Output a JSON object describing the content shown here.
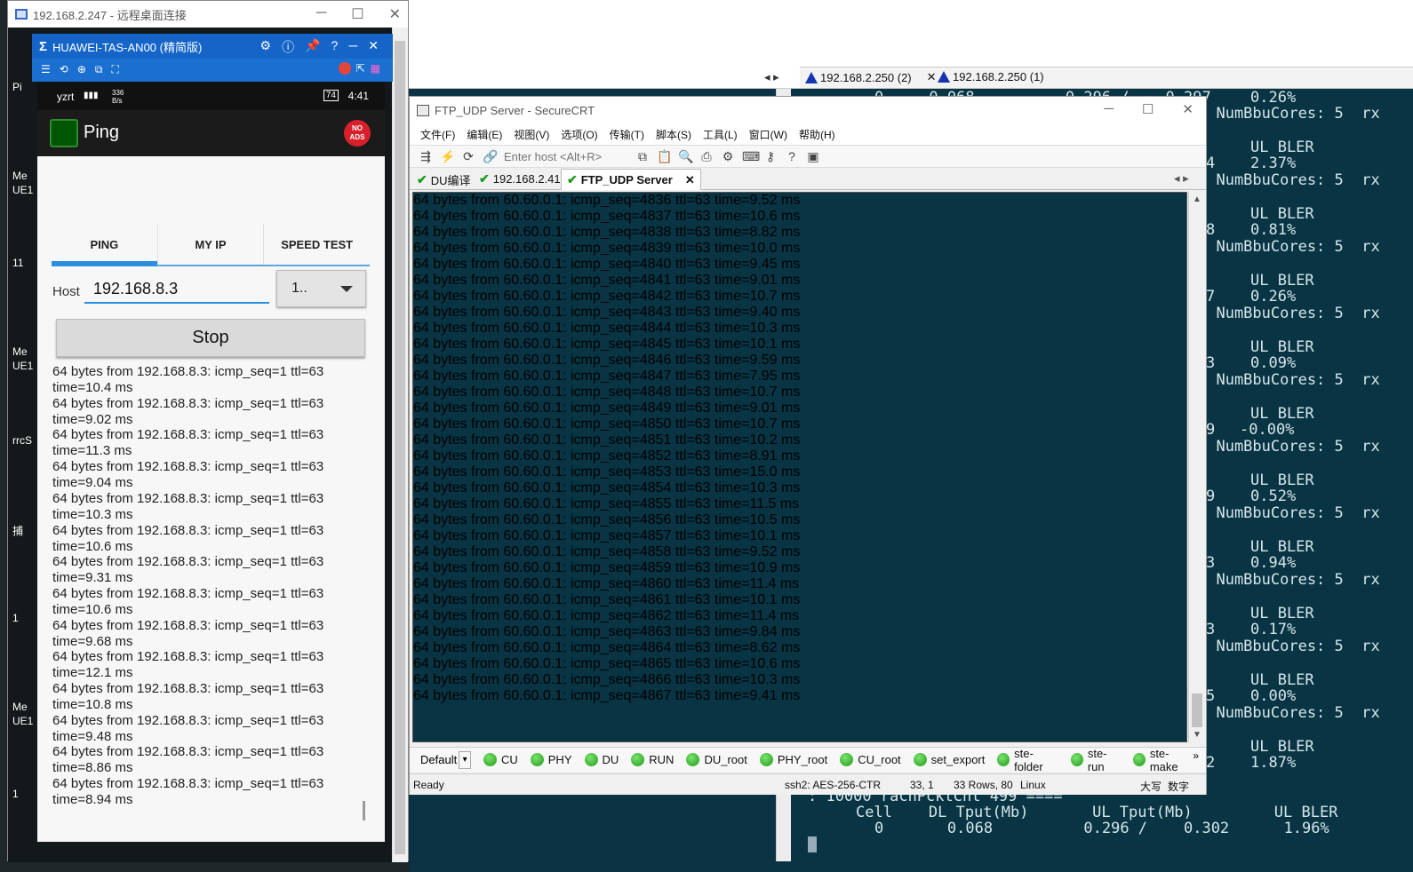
{
  "bg_window": {
    "tabs": [
      "192.168.2.250 (2)",
      "192.168.2.250 (1)"
    ],
    "rows": [
      [
        "0",
        "0.068",
        "0.296 /",
        "0.297",
        "0.26%"
      ],
      [
        "L NumBbuCores: 5  rx"
      ],
      [
        "",
        "",
        "",
        "UL BLER",
        ""
      ],
      [
        "4",
        "",
        "",
        "2.37%",
        ""
      ]
    ],
    "right_blocks": [
      {
        "label": "UL BLER",
        "value": "2.37%"
      },
      {
        "label": "UL BLER",
        "value": "0.81%"
      },
      {
        "label": "UL BLER",
        "value": "0.26%"
      },
      {
        "label": "UL BLER",
        "value": "0.09%"
      },
      {
        "label": "UL BLER",
        "value": "-0.00%"
      },
      {
        "label": "UL BLER",
        "value": "0.52%"
      },
      {
        "label": "UL BLER",
        "value": "0.94%"
      },
      {
        "label": "UL BLER",
        "value": "0.17%"
      },
      {
        "label": "UL BLER",
        "value": "0.00%"
      },
      {
        "label": "UL BLER",
        "value": "1.87%"
      }
    ],
    "top_value": "0.26%",
    "cores_line": "L NumBbuCores: 5  rx",
    "left_digits": [
      "4",
      "8",
      "7",
      "3",
      "9",
      "9",
      "3",
      "3",
      "5",
      "2"
    ],
    "footer_line1": ": 10000 rachPcktCnt 499 ====",
    "footer_header": "Cell    DL Tput(Mb)       UL Tput(Mb)         UL BLER",
    "footer_values": "0       0.068          0.296 /    0.302      1.96%",
    "top_partial": "0     0.068          0.296 /    0.297"
  },
  "rdp": {
    "title": "192.168.2.247 - 远程桌面连接",
    "side_labels": [
      "Pi",
      "Me",
      "UE1",
      "11",
      "Me",
      "UE1",
      "rrcS",
      "捕",
      "1",
      "Me",
      "UE1",
      "1"
    ]
  },
  "mirror": {
    "title": "HUAWEI-TAS-AN00 (精简版)"
  },
  "phone": {
    "status_left": "yzrt",
    "status_speed": "336 B/s",
    "battery": "74",
    "time": "4:41",
    "app_title": "Ping",
    "ads_badge": "NO ADS",
    "tabs": [
      "PING",
      "MY IP",
      "SPEED TEST"
    ],
    "host_label": "Host",
    "host_value": "192.168.8.3",
    "count_value": "1..",
    "stop_label": "Stop",
    "ping_lines": [
      [
        "64 bytes from 192.168.8.3: icmp_seq=1 ttl=63",
        "time=10.4 ms"
      ],
      [
        "64 bytes from 192.168.8.3: icmp_seq=1 ttl=63",
        "time=9.02 ms"
      ],
      [
        "64 bytes from 192.168.8.3: icmp_seq=1 ttl=63",
        "time=11.3 ms"
      ],
      [
        "64 bytes from 192.168.8.3: icmp_seq=1 ttl=63",
        "time=9.04 ms"
      ],
      [
        "64 bytes from 192.168.8.3: icmp_seq=1 ttl=63",
        "time=10.3 ms"
      ],
      [
        "64 bytes from 192.168.8.3: icmp_seq=1 ttl=63",
        "time=10.6 ms"
      ],
      [
        "64 bytes from 192.168.8.3: icmp_seq=1 ttl=63",
        "time=9.31 ms"
      ],
      [
        "64 bytes from 192.168.8.3: icmp_seq=1 ttl=63",
        "time=10.6 ms"
      ],
      [
        "64 bytes from 192.168.8.3: icmp_seq=1 ttl=63",
        "time=9.68 ms"
      ],
      [
        "64 bytes from 192.168.8.3: icmp_seq=1 ttl=63",
        "time=12.1 ms"
      ],
      [
        "64 bytes from 192.168.8.3: icmp_seq=1 ttl=63",
        "time=10.8 ms"
      ],
      [
        "64 bytes from 192.168.8.3: icmp_seq=1 ttl=63",
        "time=9.48 ms"
      ],
      [
        "64 bytes from 192.168.8.3: icmp_seq=1 ttl=63",
        "time=8.86 ms"
      ],
      [
        "64 bytes from 192.168.8.3: icmp_seq=1 ttl=63",
        "time=8.94 ms"
      ]
    ]
  },
  "crt": {
    "title": "FTP_UDP Server - SecureCRT",
    "menu": [
      "文件(F)",
      "编辑(E)",
      "视图(V)",
      "选项(O)",
      "传输(T)",
      "脚本(S)",
      "工具(L)",
      "窗口(W)",
      "帮助(H)"
    ],
    "host_placeholder": "Enter host <Alt+R>",
    "tabs": [
      "DU编译",
      "192.168.2.41",
      "FTP_UDP Server"
    ],
    "terminal_lines": [
      "64 bytes from 60.60.0.1: icmp_seq=4836 ttl=63 time=9.52 ms",
      "64 bytes from 60.60.0.1: icmp_seq=4837 ttl=63 time=10.6 ms",
      "64 bytes from 60.60.0.1: icmp_seq=4838 ttl=63 time=8.82 ms",
      "64 bytes from 60.60.0.1: icmp_seq=4839 ttl=63 time=10.0 ms",
      "64 bytes from 60.60.0.1: icmp_seq=4840 ttl=63 time=9.45 ms",
      "64 bytes from 60.60.0.1: icmp_seq=4841 ttl=63 time=9.01 ms",
      "64 bytes from 60.60.0.1: icmp_seq=4842 ttl=63 time=10.7 ms",
      "64 bytes from 60.60.0.1: icmp_seq=4843 ttl=63 time=9.40 ms",
      "64 bytes from 60.60.0.1: icmp_seq=4844 ttl=63 time=10.3 ms",
      "64 bytes from 60.60.0.1: icmp_seq=4845 ttl=63 time=10.1 ms",
      "64 bytes from 60.60.0.1: icmp_seq=4846 ttl=63 time=9.59 ms",
      "64 bytes from 60.60.0.1: icmp_seq=4847 ttl=63 time=7.95 ms",
      "64 bytes from 60.60.0.1: icmp_seq=4848 ttl=63 time=10.7 ms",
      "64 bytes from 60.60.0.1: icmp_seq=4849 ttl=63 time=9.01 ms",
      "64 bytes from 60.60.0.1: icmp_seq=4850 ttl=63 time=10.7 ms",
      "64 bytes from 60.60.0.1: icmp_seq=4851 ttl=63 time=10.2 ms",
      "64 bytes from 60.60.0.1: icmp_seq=4852 ttl=63 time=8.91 ms",
      "64 bytes from 60.60.0.1: icmp_seq=4853 ttl=63 time=15.0 ms",
      "64 bytes from 60.60.0.1: icmp_seq=4854 ttl=63 time=10.3 ms",
      "64 bytes from 60.60.0.1: icmp_seq=4855 ttl=63 time=11.5 ms",
      "64 bytes from 60.60.0.1: icmp_seq=4856 ttl=63 time=10.5 ms",
      "64 bytes from 60.60.0.1: icmp_seq=4857 ttl=63 time=10.1 ms",
      "64 bytes from 60.60.0.1: icmp_seq=4858 ttl=63 time=9.52 ms",
      "64 bytes from 60.60.0.1: icmp_seq=4859 ttl=63 time=10.9 ms",
      "64 bytes from 60.60.0.1: icmp_seq=4860 ttl=63 time=11.4 ms",
      "64 bytes from 60.60.0.1: icmp_seq=4861 ttl=63 time=10.1 ms",
      "64 bytes from 60.60.0.1: icmp_seq=4862 ttl=63 time=11.4 ms",
      "64 bytes from 60.60.0.1: icmp_seq=4863 ttl=63 time=9.84 ms",
      "64 bytes from 60.60.0.1: icmp_seq=4864 ttl=63 time=8.62 ms",
      "64 bytes from 60.60.0.1: icmp_seq=4865 ttl=63 time=10.6 ms",
      "64 bytes from 60.60.0.1: icmp_seq=4866 ttl=63 time=10.3 ms",
      "64 bytes from 60.60.0.1: icmp_seq=4867 ttl=63 time=9.41 ms"
    ],
    "session_default": "Default",
    "buttons": [
      "CU",
      "PHY",
      "DU",
      "RUN",
      "DU_root",
      "PHY_root",
      "CU_root",
      "set_export",
      "ste-folder",
      "ste-run",
      "ste-make"
    ],
    "status": {
      "ready": "Ready",
      "cipher": "ssh2: AES-256-CTR",
      "pos": "33,  1",
      "size": "33 Rows, 80",
      "os": "Linux",
      "caps": "大写",
      "num": "数字"
    }
  },
  "colors": {
    "terminal_bg": "#083444",
    "terminal_fg": "#c8d8dc",
    "accent": "#2b8fe0",
    "mirror_bar": "#1565c8"
  }
}
